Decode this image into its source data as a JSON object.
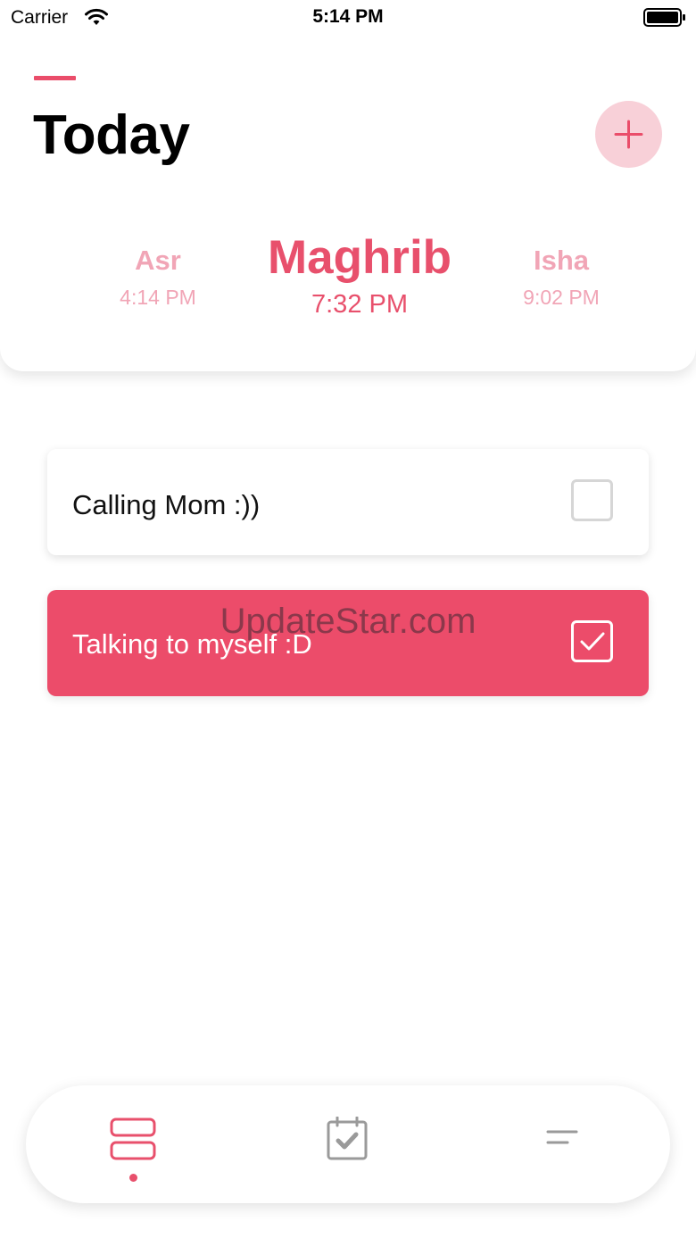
{
  "status_bar": {
    "carrier": "Carrier",
    "time": "5:14 PM",
    "wifi_icon": "wifi-icon",
    "battery_icon": "battery-icon"
  },
  "header": {
    "title": "Today",
    "add_button_icon": "plus-icon"
  },
  "prayers": {
    "asr": {
      "name": "Asr",
      "time": "4:14 PM"
    },
    "current": {
      "name": "Maghrib",
      "time": "7:32 PM"
    },
    "isha": {
      "name": "Isha",
      "time": "9:02 PM"
    }
  },
  "tasks": [
    {
      "label": "Calling Mom :))",
      "checked": false
    },
    {
      "label": "Talking to myself :D",
      "checked": true
    }
  ],
  "watermark": "UpdateStar.com",
  "bottom_nav": {
    "items": [
      {
        "icon": "list-icon",
        "active": true
      },
      {
        "icon": "calendar-check-icon",
        "active": false
      },
      {
        "icon": "menu-icon",
        "active": false
      }
    ]
  },
  "colors": {
    "accent": "#ea4d6a",
    "accent_light": "#f8d0d8",
    "muted_accent": "#f1a5b6",
    "inactive_icon": "#9a9a9a"
  }
}
